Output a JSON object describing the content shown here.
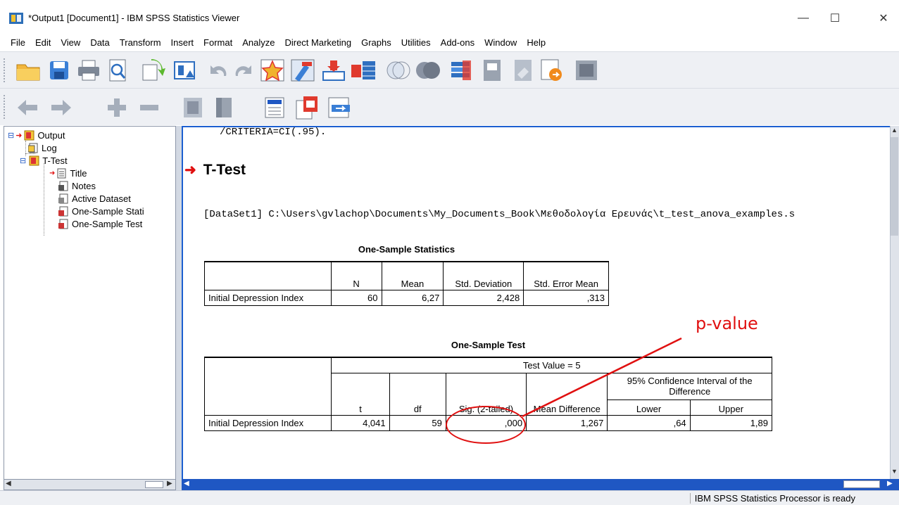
{
  "window": {
    "title": "*Output1 [Document1] - IBM SPSS Statistics Viewer",
    "minimize": "—",
    "maximize": "☐",
    "close": "✕"
  },
  "menu": [
    "File",
    "Edit",
    "View",
    "Data",
    "Transform",
    "Insert",
    "Format",
    "Analyze",
    "Direct Marketing",
    "Graphs",
    "Utilities",
    "Add-ons",
    "Window",
    "Help"
  ],
  "toolbar1": [
    "open-icon",
    "save-icon",
    "print-icon",
    "print-preview-icon",
    "export-icon",
    "recall-dialog-icon",
    "undo-icon",
    "redo-icon",
    "goto-case-icon",
    "goto-variable-icon",
    "variables-icon",
    "dataset-icon",
    "select-cases-icon",
    "weight-cases-icon",
    "split-file-icon",
    "value-labels-icon",
    "use-sets-icon",
    "show-all-variables-icon",
    "spelling-icon"
  ],
  "toolbar2": [
    "back-arrow-icon",
    "forward-arrow-icon",
    "expand-icon",
    "collapse-icon",
    "show-icon",
    "hide-icon",
    "insert-heading-icon",
    "insert-title-icon",
    "insert-text-icon"
  ],
  "tree": {
    "output": "Output",
    "log": "Log",
    "ttest": "T-Test",
    "title": "Title",
    "notes": "Notes",
    "active_dataset": "Active Dataset",
    "one_sample_stats": "One-Sample Stati",
    "one_sample_test": "One-Sample Test"
  },
  "output": {
    "syntax_line": "/CRITERIA=CI(.95).",
    "heading": "T-Test",
    "dataset_line": "[DataSet1] C:\\Users\\gvlachop\\Documents\\My_Documents_Book\\Μεθοδολογία Ερευνάς\\t_test_anova_examples.s"
  },
  "stats_table": {
    "title": "One-Sample Statistics",
    "headers": [
      "N",
      "Mean",
      "Std. Deviation",
      "Std. Error Mean"
    ],
    "row_label": "Initial Depression Index",
    "values": [
      "60",
      "6,27",
      "2,428",
      ",313"
    ]
  },
  "test_table": {
    "title": "One-Sample Test",
    "test_value": "Test Value = 5",
    "headers": [
      "t",
      "df",
      "Sig. (2-tailed)",
      "Mean Difference"
    ],
    "ci_header": "95% Confidence Interval of the Difference",
    "ci_sub": [
      "Lower",
      "Upper"
    ],
    "row_label": "Initial Depression Index",
    "values": [
      "4,041",
      "59",
      ",000",
      "1,267",
      ",64",
      "1,89"
    ]
  },
  "annotation": {
    "label": "p-value",
    "color": "#e01010"
  },
  "status": {
    "text": "IBM SPSS Statistics Processor is ready"
  }
}
